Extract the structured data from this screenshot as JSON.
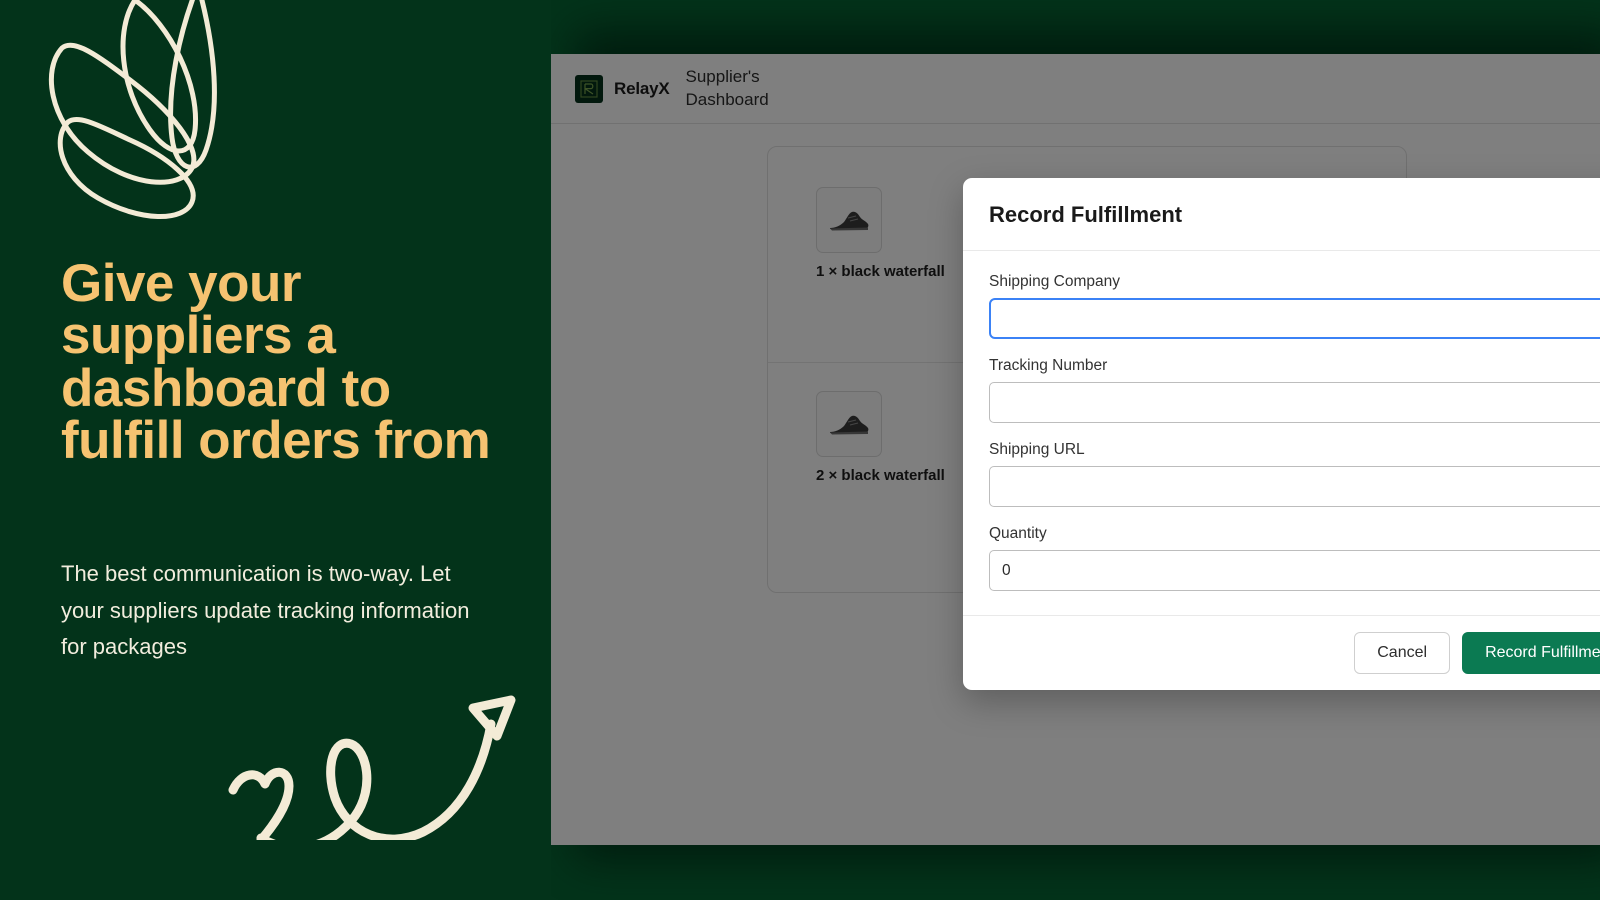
{
  "marketing": {
    "headline": "Give your suppliers a dashboard to fulfill orders from",
    "subtext": "The best communication is two-way. Let your suppliers update tracking information for packages",
    "colors": {
      "background": "#03331a",
      "headline": "#F6C371",
      "subtext": "#F2EDDD",
      "doodle": "#F3EBD6"
    }
  },
  "app": {
    "header": {
      "brand_name": "RelayX",
      "subtitle": "Supplier's Dashboard",
      "logo_icon": "relayx-logo-icon"
    },
    "order_card": {
      "line_items": [
        {
          "label": "1 × black waterfall",
          "thumb_icon": "sneaker-icon"
        },
        {
          "label": "2 × black waterfall",
          "thumb_icon": "sneaker-icon"
        }
      ]
    }
  },
  "modal": {
    "title": "Record Fulfillment",
    "fields": [
      {
        "label": "Shipping Company",
        "value": "",
        "placeholder": "",
        "focused": true
      },
      {
        "label": "Tracking Number",
        "value": "",
        "placeholder": "",
        "focused": false
      },
      {
        "label": "Shipping URL",
        "value": "",
        "placeholder": "",
        "focused": false
      },
      {
        "label": "Quantity",
        "value": "0",
        "placeholder": "",
        "focused": false
      }
    ],
    "buttons": {
      "cancel": "Cancel",
      "submit": "Record Fulfillment"
    },
    "accent_color": "#0B7A52",
    "focus_color": "#3b82f6"
  }
}
